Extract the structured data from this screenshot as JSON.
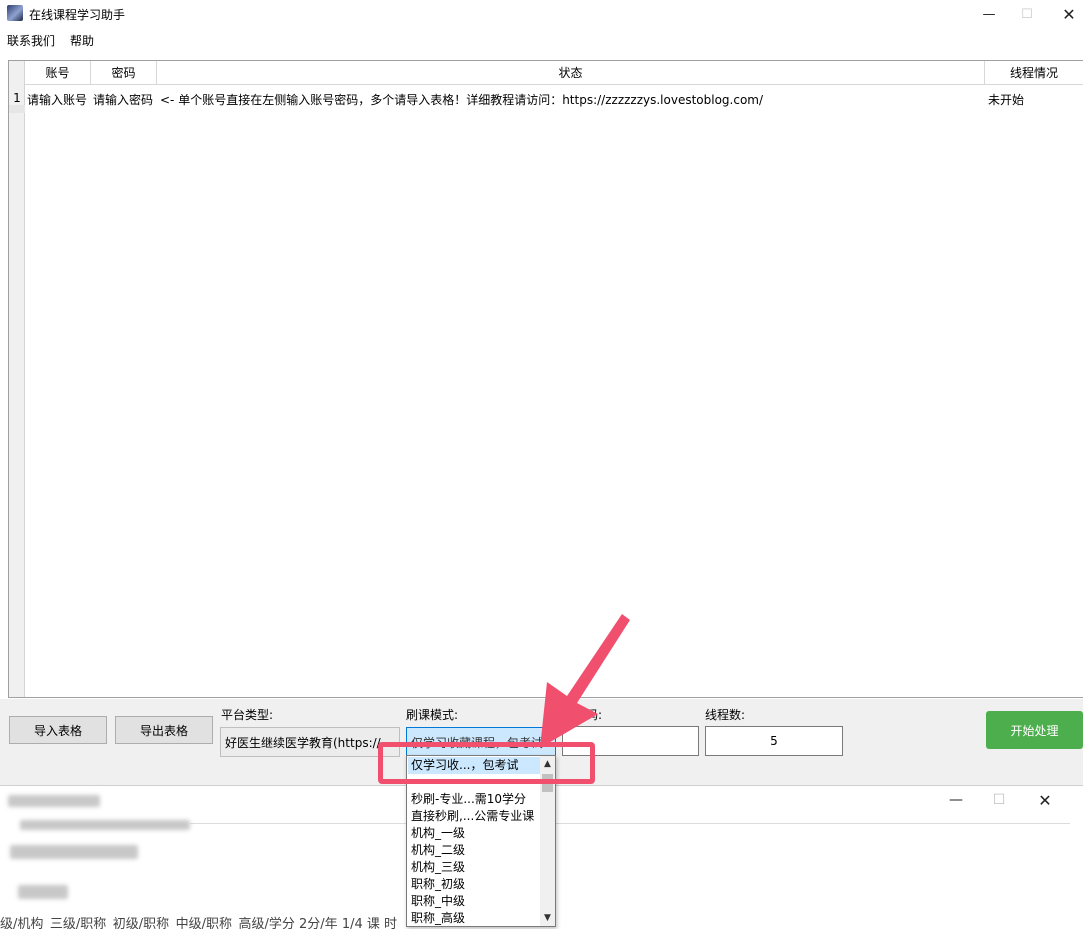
{
  "window": {
    "title": "在线课程学习助手",
    "controls": [
      "—",
      "☐",
      "✕"
    ]
  },
  "menu": {
    "items": [
      "联系我们",
      "帮助"
    ]
  },
  "grid": {
    "columns": [
      "账号",
      "密码",
      "状态",
      "线程情况"
    ],
    "rows": [
      {
        "num": "1",
        "account": "请输入账号",
        "password": "请输入密码",
        "status": "<- 单个账号直接在左侧输入账号密码，多个请导入表格！详细教程请访问：https://zzzzzzys.lovestoblog.com/",
        "thread": "未开始"
      }
    ]
  },
  "controls": {
    "import_label": "导入表格",
    "export_label": "导出表格",
    "platform_label": "平台类型:",
    "platform_value": "好医生继续医学教育(https://",
    "mode_label": "刷课模式:",
    "mode_value": "仅学习收藏课程，包考试",
    "auth_label": "授权码:",
    "auth_value": "",
    "threads_label": "线程数:",
    "threads_value": "5",
    "start_label": "开始处理"
  },
  "dropdown": {
    "items": [
      "仅学习收...，包考试",
      "",
      "秒刷-专业...需10学分",
      "直接秒刷,...公需专业课",
      "机构_一级",
      "机构_二级",
      "机构_三级",
      "职称_初级",
      "职称_中级",
      "职称_高级"
    ],
    "selected_index": 0
  },
  "background_window": {
    "controls": [
      "—",
      "☐",
      "✕"
    ],
    "bottom_text": "级/机构_三级/职称_初级/职称_中级/职称_高级/学分 2分/年 1/4 课 时"
  },
  "colors": {
    "accent": "#0078d7",
    "start_button": "#4cae4c",
    "annotation": "#f0506e",
    "selection": "#cce8ff"
  }
}
